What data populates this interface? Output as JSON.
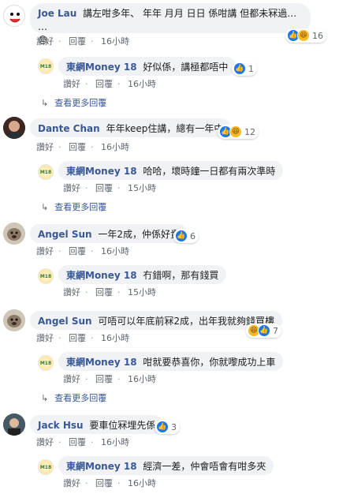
{
  "labels": {
    "like": "讚好",
    "reply": "回覆",
    "more_replies": "查看更多回覆"
  },
  "threads": [
    {
      "author": "Joe Lau",
      "text": "講左咁多年、 年年 月月 日日 係咁講 但都未冧過… …",
      "text_extra": "😓",
      "reactions": "16",
      "time": "16小時",
      "reply": {
        "author": "東網Money 18",
        "text": "好似係，講極都唔中",
        "reactions": "1",
        "time": "16小時"
      }
    },
    {
      "author": "Dante Chan",
      "text": "年年keep住講，總有一年中",
      "reactions": "12",
      "time": "16小時",
      "reply": {
        "author": "東網Money 18",
        "text": "哈哈，壞時鐘一日都有兩次準時",
        "time": "15小時"
      }
    },
    {
      "author": "Angel Sun",
      "text": "一年2成，仲係好貴",
      "reactions": "6",
      "time": "16小時",
      "reply": {
        "author": "東網Money 18",
        "text": "冇錯啊，那有錢買",
        "time": "15小時"
      }
    },
    {
      "author": "Angel Sun",
      "text": "可唔可以年底前冧2成，出年我就夠錢買樓",
      "reactions": "7",
      "time": "16小時",
      "reply": {
        "author": "東網Money 18",
        "text": "咁就要恭喜你，你就嚟成功上車",
        "time": "16小時"
      }
    },
    {
      "author": "Jack Hsu",
      "text": "要車位冧埋先係",
      "reactions": "3",
      "time": "16小時",
      "reply": {
        "author": "東網Money 18",
        "text": "經濟一差，仲會唔會有咁多夾",
        "time": "16小時"
      }
    }
  ]
}
